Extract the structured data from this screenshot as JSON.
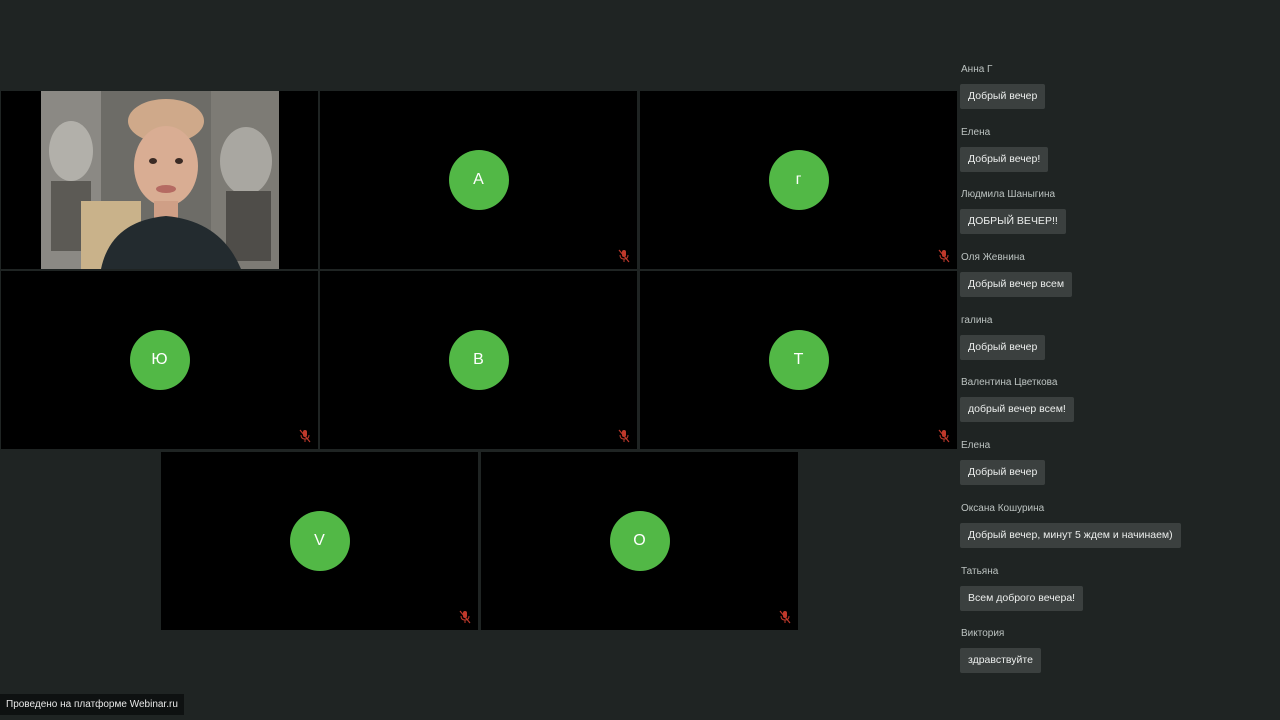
{
  "participants": [
    {
      "initial": "",
      "has_video": true,
      "muted": false
    },
    {
      "initial": "А",
      "has_video": false,
      "muted": true
    },
    {
      "initial": "г",
      "has_video": false,
      "muted": true
    },
    {
      "initial": "Ю",
      "has_video": false,
      "muted": true
    },
    {
      "initial": "В",
      "has_video": false,
      "muted": true
    },
    {
      "initial": "Т",
      "has_video": false,
      "muted": true
    },
    {
      "initial": "V",
      "has_video": false,
      "muted": true
    },
    {
      "initial": "О",
      "has_video": false,
      "muted": true
    }
  ],
  "chat": {
    "messages": [
      {
        "author": "Анна Г",
        "text": "Добрый вечер"
      },
      {
        "author": "Елена",
        "text": "Добрый вечер!"
      },
      {
        "author": "Людмила Шаныгина",
        "text": "ДОБРЫЙ ВЕЧЕР!!"
      },
      {
        "author": "Оля Жевнина",
        "text": "Добрый вечер всем"
      },
      {
        "author": "галина",
        "text": "Добрый вечер"
      },
      {
        "author": "Валентина Цветкова",
        "text": "добрый вечер всем!"
      },
      {
        "author": "Елена",
        "text": "Добрый вечер"
      },
      {
        "author": "Оксана Кошурина",
        "text": "Добрый вечер, минут 5 ждем и начинаем)"
      },
      {
        "author": "Татьяна",
        "text": "Всем доброго вечера!"
      },
      {
        "author": "Виктория",
        "text": "здравствуйте"
      }
    ]
  },
  "footer": {
    "text": "Проведено на платформе Webinar.ru"
  },
  "colors": {
    "avatar": "#52b846",
    "mute_icon": "#c0392b",
    "background": "#1f2423"
  },
  "icons": {
    "mute": "microphone-muted-icon"
  }
}
